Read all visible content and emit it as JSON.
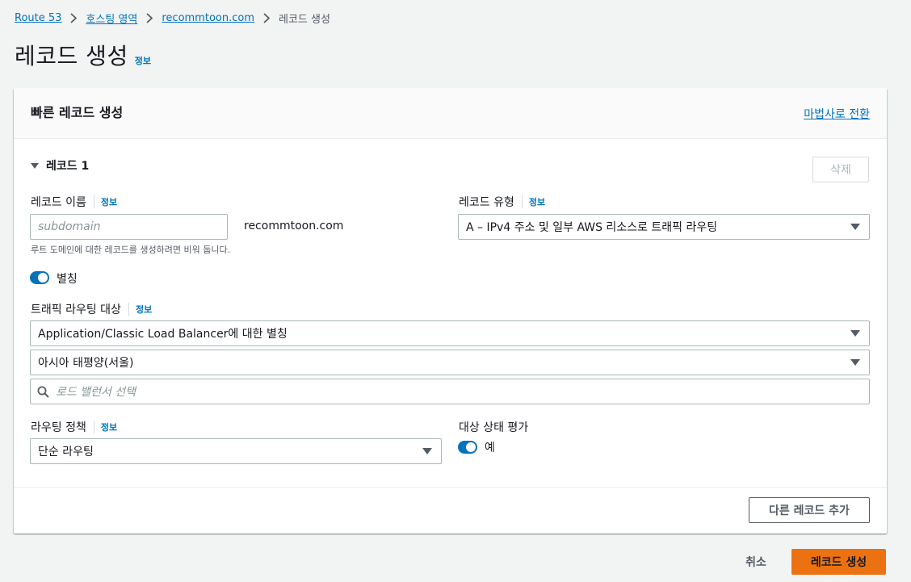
{
  "breadcrumb": {
    "items": [
      "Route 53",
      "호스팅 영역",
      "recommtoon.com"
    ],
    "current": "레코드 생성"
  },
  "page": {
    "title": "레코드 생성",
    "info": "정보"
  },
  "card": {
    "title": "빠른 레코드 생성",
    "wizard_link": "마법사로 전환"
  },
  "record": {
    "section_title": "레코드 1",
    "delete_label": "삭제",
    "name_label": "레코드 이름",
    "name_info": "정보",
    "name_placeholder": "subdomain",
    "domain_suffix": "recommtoon.com",
    "name_hint": "루트 도메인에 대한 레코드를 생성하려면 비워 둡니다.",
    "type_label": "레코드 유형",
    "type_info": "정보",
    "type_value": "A – IPv4 주소 및 일부 AWS 리소스로 트래픽 라우팅",
    "alias_label": "별칭",
    "alias_on": true,
    "target_label": "트래픽 라우팅 대상",
    "target_info": "정보",
    "endpoint_value": "Application/Classic Load Balancer에 대한 별칭",
    "region_value": "아시아 태평양(서울)",
    "lb_placeholder": "로드 밸런서 선택",
    "policy_label": "라우팅 정책",
    "policy_info": "정보",
    "policy_value": "단순 라우팅",
    "health_label": "대상 상태 평가",
    "health_value": "예",
    "health_on": true
  },
  "actions": {
    "add_record": "다른 레코드 추가",
    "cancel": "취소",
    "create": "레코드 생성"
  },
  "colors": {
    "link": "#0073bb",
    "primary": "#ec7211",
    "toggle": "#0073bb",
    "background": "#f2f3f3"
  },
  "icons": {
    "separator": "chevron-right-icon",
    "expand": "caret-down-icon",
    "dropdown": "caret-down-icon",
    "search": "search-icon"
  }
}
